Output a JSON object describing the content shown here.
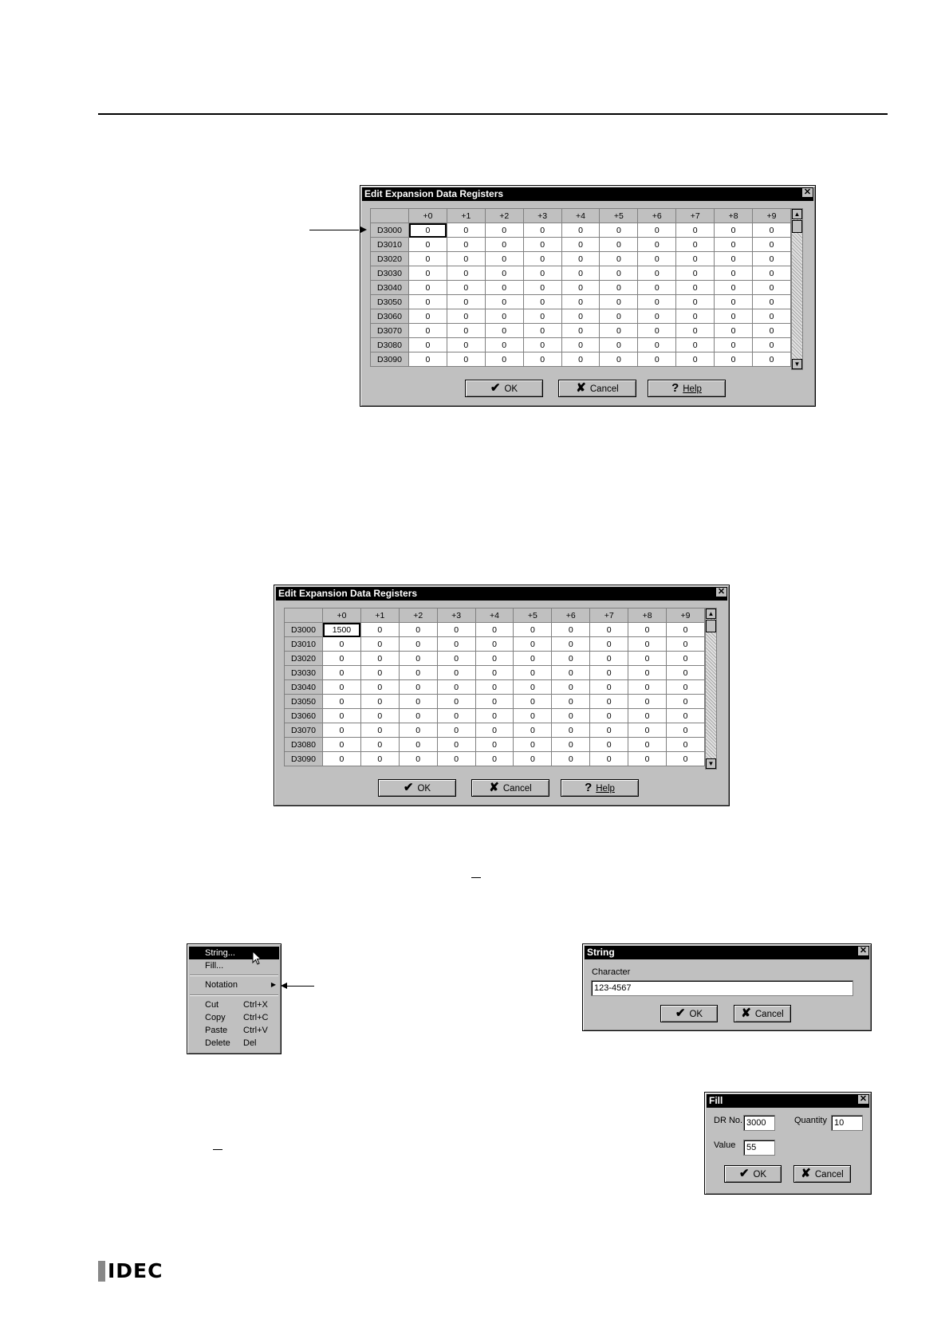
{
  "dialog1": {
    "title": "Edit Expansion Data Registers",
    "columns": [
      "+0",
      "+1",
      "+2",
      "+3",
      "+4",
      "+5",
      "+6",
      "+7",
      "+8",
      "+9"
    ],
    "rows": [
      {
        "label": "D3000",
        "values": [
          "0",
          "0",
          "0",
          "0",
          "0",
          "0",
          "0",
          "0",
          "0",
          "0"
        ]
      },
      {
        "label": "D3010",
        "values": [
          "0",
          "0",
          "0",
          "0",
          "0",
          "0",
          "0",
          "0",
          "0",
          "0"
        ]
      },
      {
        "label": "D3020",
        "values": [
          "0",
          "0",
          "0",
          "0",
          "0",
          "0",
          "0",
          "0",
          "0",
          "0"
        ]
      },
      {
        "label": "D3030",
        "values": [
          "0",
          "0",
          "0",
          "0",
          "0",
          "0",
          "0",
          "0",
          "0",
          "0"
        ]
      },
      {
        "label": "D3040",
        "values": [
          "0",
          "0",
          "0",
          "0",
          "0",
          "0",
          "0",
          "0",
          "0",
          "0"
        ]
      },
      {
        "label": "D3050",
        "values": [
          "0",
          "0",
          "0",
          "0",
          "0",
          "0",
          "0",
          "0",
          "0",
          "0"
        ]
      },
      {
        "label": "D3060",
        "values": [
          "0",
          "0",
          "0",
          "0",
          "0",
          "0",
          "0",
          "0",
          "0",
          "0"
        ]
      },
      {
        "label": "D3070",
        "values": [
          "0",
          "0",
          "0",
          "0",
          "0",
          "0",
          "0",
          "0",
          "0",
          "0"
        ]
      },
      {
        "label": "D3080",
        "values": [
          "0",
          "0",
          "0",
          "0",
          "0",
          "0",
          "0",
          "0",
          "0",
          "0"
        ]
      },
      {
        "label": "D3090",
        "values": [
          "0",
          "0",
          "0",
          "0",
          "0",
          "0",
          "0",
          "0",
          "0",
          "0"
        ]
      }
    ],
    "ok": "OK",
    "cancel": "Cancel",
    "help": "Help"
  },
  "dialog2": {
    "title": "Edit Expansion Data Registers",
    "columns": [
      "+0",
      "+1",
      "+2",
      "+3",
      "+4",
      "+5",
      "+6",
      "+7",
      "+8",
      "+9"
    ],
    "rows": [
      {
        "label": "D3000",
        "values": [
          "1500",
          "0",
          "0",
          "0",
          "0",
          "0",
          "0",
          "0",
          "0",
          "0"
        ]
      },
      {
        "label": "D3010",
        "values": [
          "0",
          "0",
          "0",
          "0",
          "0",
          "0",
          "0",
          "0",
          "0",
          "0"
        ]
      },
      {
        "label": "D3020",
        "values": [
          "0",
          "0",
          "0",
          "0",
          "0",
          "0",
          "0",
          "0",
          "0",
          "0"
        ]
      },
      {
        "label": "D3030",
        "values": [
          "0",
          "0",
          "0",
          "0",
          "0",
          "0",
          "0",
          "0",
          "0",
          "0"
        ]
      },
      {
        "label": "D3040",
        "values": [
          "0",
          "0",
          "0",
          "0",
          "0",
          "0",
          "0",
          "0",
          "0",
          "0"
        ]
      },
      {
        "label": "D3050",
        "values": [
          "0",
          "0",
          "0",
          "0",
          "0",
          "0",
          "0",
          "0",
          "0",
          "0"
        ]
      },
      {
        "label": "D3060",
        "values": [
          "0",
          "0",
          "0",
          "0",
          "0",
          "0",
          "0",
          "0",
          "0",
          "0"
        ]
      },
      {
        "label": "D3070",
        "values": [
          "0",
          "0",
          "0",
          "0",
          "0",
          "0",
          "0",
          "0",
          "0",
          "0"
        ]
      },
      {
        "label": "D3080",
        "values": [
          "0",
          "0",
          "0",
          "0",
          "0",
          "0",
          "0",
          "0",
          "0",
          "0"
        ]
      },
      {
        "label": "D3090",
        "values": [
          "0",
          "0",
          "0",
          "0",
          "0",
          "0",
          "0",
          "0",
          "0",
          "0"
        ]
      }
    ],
    "ok": "OK",
    "cancel": "Cancel",
    "help": "Help"
  },
  "context_menu": {
    "items": [
      {
        "label": "String...",
        "shortcut": ""
      },
      {
        "label": "Fill...",
        "shortcut": ""
      },
      {
        "label": "Notation",
        "shortcut": ""
      },
      {
        "label": "Cut",
        "shortcut": "Ctrl+X"
      },
      {
        "label": "Copy",
        "shortcut": "Ctrl+C"
      },
      {
        "label": "Paste",
        "shortcut": "Ctrl+V"
      },
      {
        "label": "Delete",
        "shortcut": "Del"
      }
    ]
  },
  "string_dialog": {
    "title": "String",
    "character_label": "Character",
    "character_value": "123-4567",
    "ok": "OK",
    "cancel": "Cancel"
  },
  "fill_dialog": {
    "title": "Fill",
    "dr_no_label": "DR No.",
    "dr_no_value": "3000",
    "quantity_label": "Quantity",
    "quantity_value": "10",
    "value_label": "Value",
    "value_value": "55",
    "ok": "OK",
    "cancel": "Cancel"
  },
  "footer": {
    "logo": "IDEC"
  }
}
